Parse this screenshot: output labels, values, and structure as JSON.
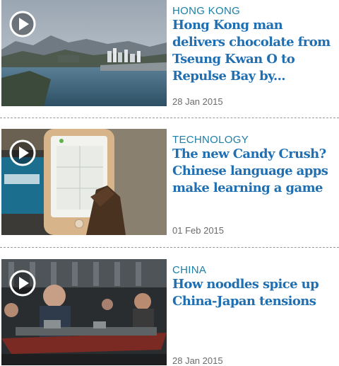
{
  "articles": [
    {
      "category": "HONG KONG",
      "headline": "Hong Kong man delivers chocolate from Tseung Kwan O to Repulse Bay by...",
      "date": "28 Jan 2015",
      "thumbnail": "aerial-bay-image",
      "play_icon": "play-icon"
    },
    {
      "category": "TECHNOLOGY",
      "headline": "The new Candy Crush? Chinese language apps make learning a game",
      "date": "01 Feb 2015",
      "thumbnail": "phone-app-image",
      "play_icon": "play-icon"
    },
    {
      "category": "CHINA",
      "headline": "How noodles spice up China-Japan tensions",
      "date": "28 Jan 2015",
      "thumbnail": "warship-model-image",
      "play_icon": "play-icon"
    }
  ],
  "colors": {
    "category": "#1b7fa6",
    "headline": "#1f6fb2",
    "date": "#6b6b6b",
    "divider": "#9a9a9a"
  }
}
